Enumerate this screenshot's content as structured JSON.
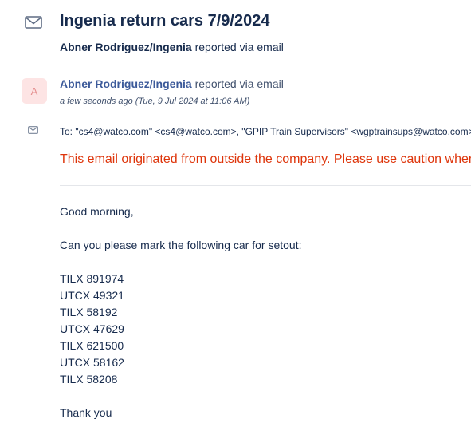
{
  "ticket": {
    "title": "Ingenia return cars 7/9/2024",
    "reporter": "Abner Rodriguez/Ingenia",
    "reported_via": "reported via email"
  },
  "message": {
    "avatar_letter": "A",
    "author": "Abner Rodriguez/Ingenia",
    "reported_via": "reported via email",
    "timestamp": "a few seconds ago (Tue, 9 Jul 2024 at 11:06 AM)",
    "to_label": "To:",
    "to_value": "\"cs4@watco.com\" <cs4@watco.com>, \"GPIP Train Supervisors\" <wgptrainsups@watco.com>",
    "warning": "This email originated from outside the company. Please use caution when",
    "greeting": "Good morning,",
    "request": "Can you please mark the following car for setout:",
    "cars": [
      "TILX 891974",
      "UTCX 49321",
      "TILX 58192",
      "UTCX 47629",
      "TILX 621500",
      "UTCX 58162",
      "TILX 58208"
    ],
    "closing": "Thank you"
  },
  "icons": {
    "header": "envelope-icon",
    "recipients": "envelope-icon"
  },
  "colors": {
    "warning": "#de350b",
    "author_link": "#3c5a9a",
    "avatar_bg": "#fde4e4"
  }
}
